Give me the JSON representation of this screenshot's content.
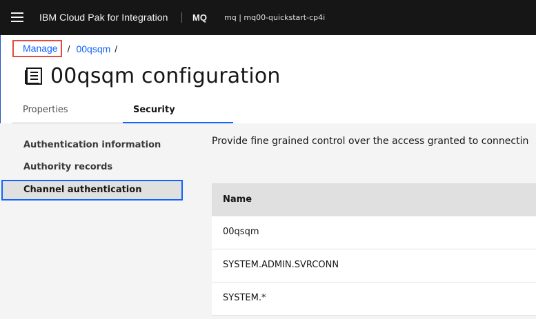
{
  "header": {
    "product_name": "IBM Cloud Pak for Integration",
    "app_name": "MQ",
    "instance_name": "mq | mq00-quickstart-cp4i"
  },
  "breadcrumb": {
    "items": [
      "Manage",
      "00qsqm"
    ],
    "separator": "/"
  },
  "page": {
    "title": "00qsqm configuration",
    "title_icon": "document-icon"
  },
  "tabs": [
    {
      "label": "Properties",
      "selected": false
    },
    {
      "label": "Security",
      "selected": true
    }
  ],
  "side_nav": {
    "items": [
      {
        "label": "Authentication information",
        "selected": false
      },
      {
        "label": "Authority records",
        "selected": false
      },
      {
        "label": "Channel authentication",
        "selected": true
      }
    ]
  },
  "main": {
    "description": "Provide fine grained control over the access granted to connectin"
  },
  "table": {
    "columns": [
      "Name"
    ],
    "rows": [
      "00qsqm",
      "SYSTEM.ADMIN.SVRCONN",
      "SYSTEM.*"
    ]
  },
  "colors": {
    "header_bg": "#161616",
    "link": "#0f62fe",
    "focus": "#0f62fe",
    "highlight_box": "#e5483e",
    "content_bg": "#f4f4f4"
  }
}
